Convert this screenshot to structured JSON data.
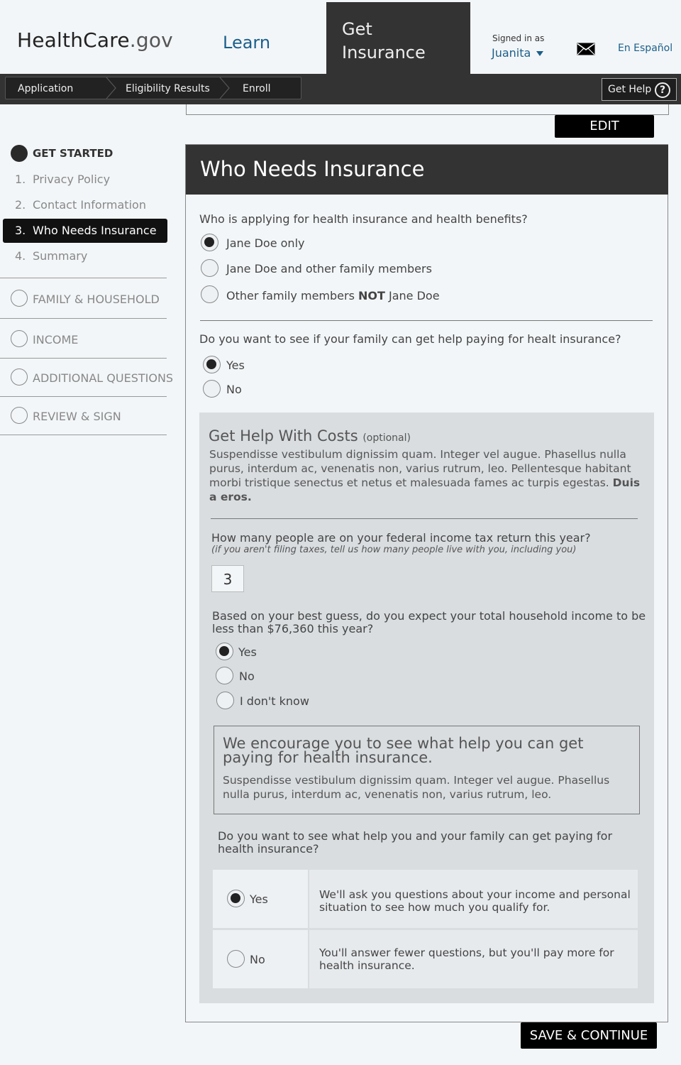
{
  "header": {
    "logo_main": "HealthCare",
    "logo_dim": ".gov",
    "nav_learn": "Learn",
    "nav_get_line1": "Get",
    "nav_get_line2": "Insurance",
    "signed_in_label": "Signed in as",
    "user_name": "Juanita",
    "mail_icon": "envelope-icon",
    "espanol": "En Español"
  },
  "breadcrumb": {
    "items": [
      "Application",
      "Eligibility Results",
      "Enroll"
    ],
    "get_help": "Get Help",
    "help_icon": "question-circle-icon",
    "help_glyph": "?"
  },
  "sidebar": {
    "get_started": "GET STARTED",
    "steps": [
      {
        "num": "1.",
        "label": "Privacy Policy"
      },
      {
        "num": "2.",
        "label": "Contact Information"
      },
      {
        "num": "3.",
        "label": "Who Needs Insurance"
      },
      {
        "num": "4.",
        "label": "Summary"
      }
    ],
    "sections": [
      "FAMILY & HOUSEHOLD",
      "INCOME",
      "ADDITIONAL QUESTIONS",
      "REVIEW & SIGN"
    ]
  },
  "edit_label": "EDIT",
  "panel": {
    "title": "Who Needs Insurance",
    "q1": "Who is applying for health insurance and health benefits?",
    "q1_options": {
      "a": "Jane Doe only",
      "b": "Jane Doe and other family members",
      "c_pre": "Other family members ",
      "c_bold": "NOT",
      "c_post": " Jane Doe"
    },
    "q1_selected": "Jane Doe only",
    "q2": "Do you want to see if your family  can get  help paying for healt insurance?",
    "q2_options": [
      "Yes",
      "No"
    ],
    "q2_selected": "Yes"
  },
  "help": {
    "title": "Get Help With Costs",
    "optional": "(optional)",
    "body": "Suspendisse vestibulum dignissim quam. Integer vel augue. Phasellus nulla purus, interdum ac, venenatis non, varius rutrum, leo. Pellentesque habitant morbi tristique senectus et netus et malesuada fames ac turpis egestas. ",
    "body_bold": "Duis a eros.",
    "q_people": "How many people are on your  federal income tax return this year?",
    "q_people_hint": "(if you aren't filing taxes, tell us how many people live with you, including you)",
    "people_value": "3",
    "q_income_line1": "Based on your best guess, do you expect your total household income to be",
    "q_income_line2": "less than $76,360 this year?",
    "income_options": [
      "Yes",
      "No",
      "I don't know"
    ],
    "income_selected": "Yes",
    "encourage_title": "We encourage you  to see what help you can get paying for health insurance.",
    "encourage_body": "Suspendisse vestibulum dignissim quam. Integer vel augue. Phasellus nulla purus, interdum ac, venenatis non, varius rutrum, leo.",
    "q_final": "Do you want to see what help you and your family can get paying for health insurance?",
    "final_options": [
      {
        "label": "Yes",
        "desc": "We'll ask you questions about your income and personal situation to see how much you qualify for."
      },
      {
        "label": "No",
        "desc": "You'll answer fewer questions, but you'll pay more for health insurance."
      }
    ],
    "final_selected": "Yes"
  },
  "save_label": "SAVE & CONTINUE"
}
